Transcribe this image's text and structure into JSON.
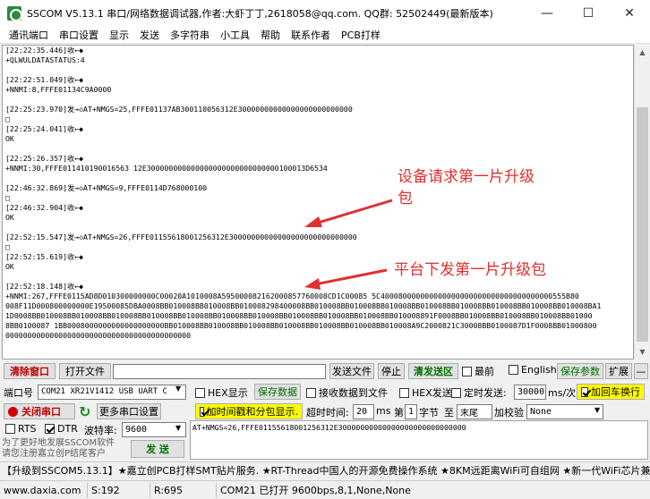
{
  "window": {
    "title": "SSCOM V5.13.1 串口/网络数据调试器,作者:大虾丁丁,2618058@qq.com. QQ群: 52502449(最新版本)",
    "minimize": "—",
    "maximize": "☐",
    "close": "✕"
  },
  "menu": [
    "通讯端口",
    "串口设置",
    "显示",
    "发送",
    "多字符串",
    "小工具",
    "帮助",
    "联系作者",
    "PCB打样"
  ],
  "receive_lines": [
    "[22:22:35.446]收←◆",
    "+QLWULDATASTATUS:4",
    "",
    "[22:22:51.049]收←◆",
    "+NNMI:8,FFFE01134C9A0000",
    "",
    "[22:25:23.970]发→◇AT+NMGS=25,FFFE01137AB300110056312E30000000000000000000000000",
    "□",
    "[22:25:24.041]收←◆",
    "OK",
    "",
    "[22:25:26.357]收←◆",
    "+NNMI:30,FFFE011410190016563 12E300000000000000000000000000000100013D6534",
    "",
    "[22:46:32.869]发→◇AT+NMGS=9,FFFE0114D768000100",
    "□",
    "[22:46:32.904]收←◆",
    "OK",
    "",
    "[22:52:15.547]发→◇AT+NMGS=26,FFFE01155618001256312E30000000000000000000000000000",
    "□",
    "[22:52:15.619]收←◆",
    "OK",
    "",
    "[22:52:18.148]收←◆",
    "+NNMI:267,FFFE0115AD8D010300000000C00020A1010008A595000082162000857760008CD1C00085 5C400080000000000000000000000000000000000555B80",
    "008F11D000800000000E19500085DBA0008BB010008BB010008BB010008298400008BB010008BB010008BB010008BB010008BB010008BB010008BB010008BB010008BA1",
    "1D0008BB010008BB010008BB010008BB010008BB010008BB010008BB010008BB010008BB010008BB010008BB010008891F0008BB010008BB010008BB010008BB01000",
    "8BB0100087 1BB0008000000000000000000BB010008BB010008BB010008BB010008BB010008BB010008BB010008A9C2000821C30008BB0100087D1F0008BB01000800",
    "000000000000000000000000000000000000000000"
  ],
  "annotations": {
    "request_line1": "设备请求第一片升级",
    "request_line2": "包",
    "platform": "平台下发第一片升级包"
  },
  "toolbar1": {
    "clear_window": "清除窗口",
    "open_file": "打开文件",
    "file_path": "",
    "send_file": "发送文件",
    "stop": "停止",
    "clear_send": "清发送区",
    "topmost": "最前",
    "english": "English",
    "save_params": "保存参数",
    "expand": "扩展",
    "dash": "—"
  },
  "toolbar2": {
    "port_label": "端口号",
    "port_value": "COM21 XR21V1412 USB UART C",
    "hex_display": "HEX显示",
    "save_data": "保存数据",
    "recv_to_file": "接收数据到文件",
    "hex_send": "HEX发送",
    "timed_send": "定时发送:",
    "interval": "30000",
    "interval_unit": "ms/次",
    "add_crlf": "加回车换行"
  },
  "toolbar3": {
    "close_port": "关闭串口",
    "more_settings": "更多串口设置",
    "timestamp": "加时间戳和分包显示.",
    "timeout_label": "超时时间:",
    "timeout": "20",
    "ms": "ms",
    "nth_label": "第",
    "nth": "1",
    "byte_label": "字节",
    "to_label": "至",
    "to_value": "末尾",
    "checksum_label": "加校验",
    "checksum_value": "None"
  },
  "toolbar4": {
    "rts": "RTS",
    "dtr": "DTR",
    "baud_label": "波特率:",
    "baud_value": "9600",
    "send_text": "AT+NMGS=26,FFFE01155618001256312E30000000000000000000000000000"
  },
  "promo": {
    "line1": "为了更好地发展SSCOM软件",
    "line2": "请您注册嘉立创P结尾客户",
    "send_button": "发 送"
  },
  "ad_text": "【升级到SSCOM5.13.1】★嘉立创PCB打样SMT贴片服务. ★RT-Thread中国人的开源免费操作系统 ★8KM远距离WiFi可自组网 ★新一代WiFi芯片兼容",
  "status": {
    "site": "www.daxia.com",
    "sent": "S:192",
    "recv": "R:695",
    "port": "COM21 已打开  9600bps,8,1,None,None"
  }
}
